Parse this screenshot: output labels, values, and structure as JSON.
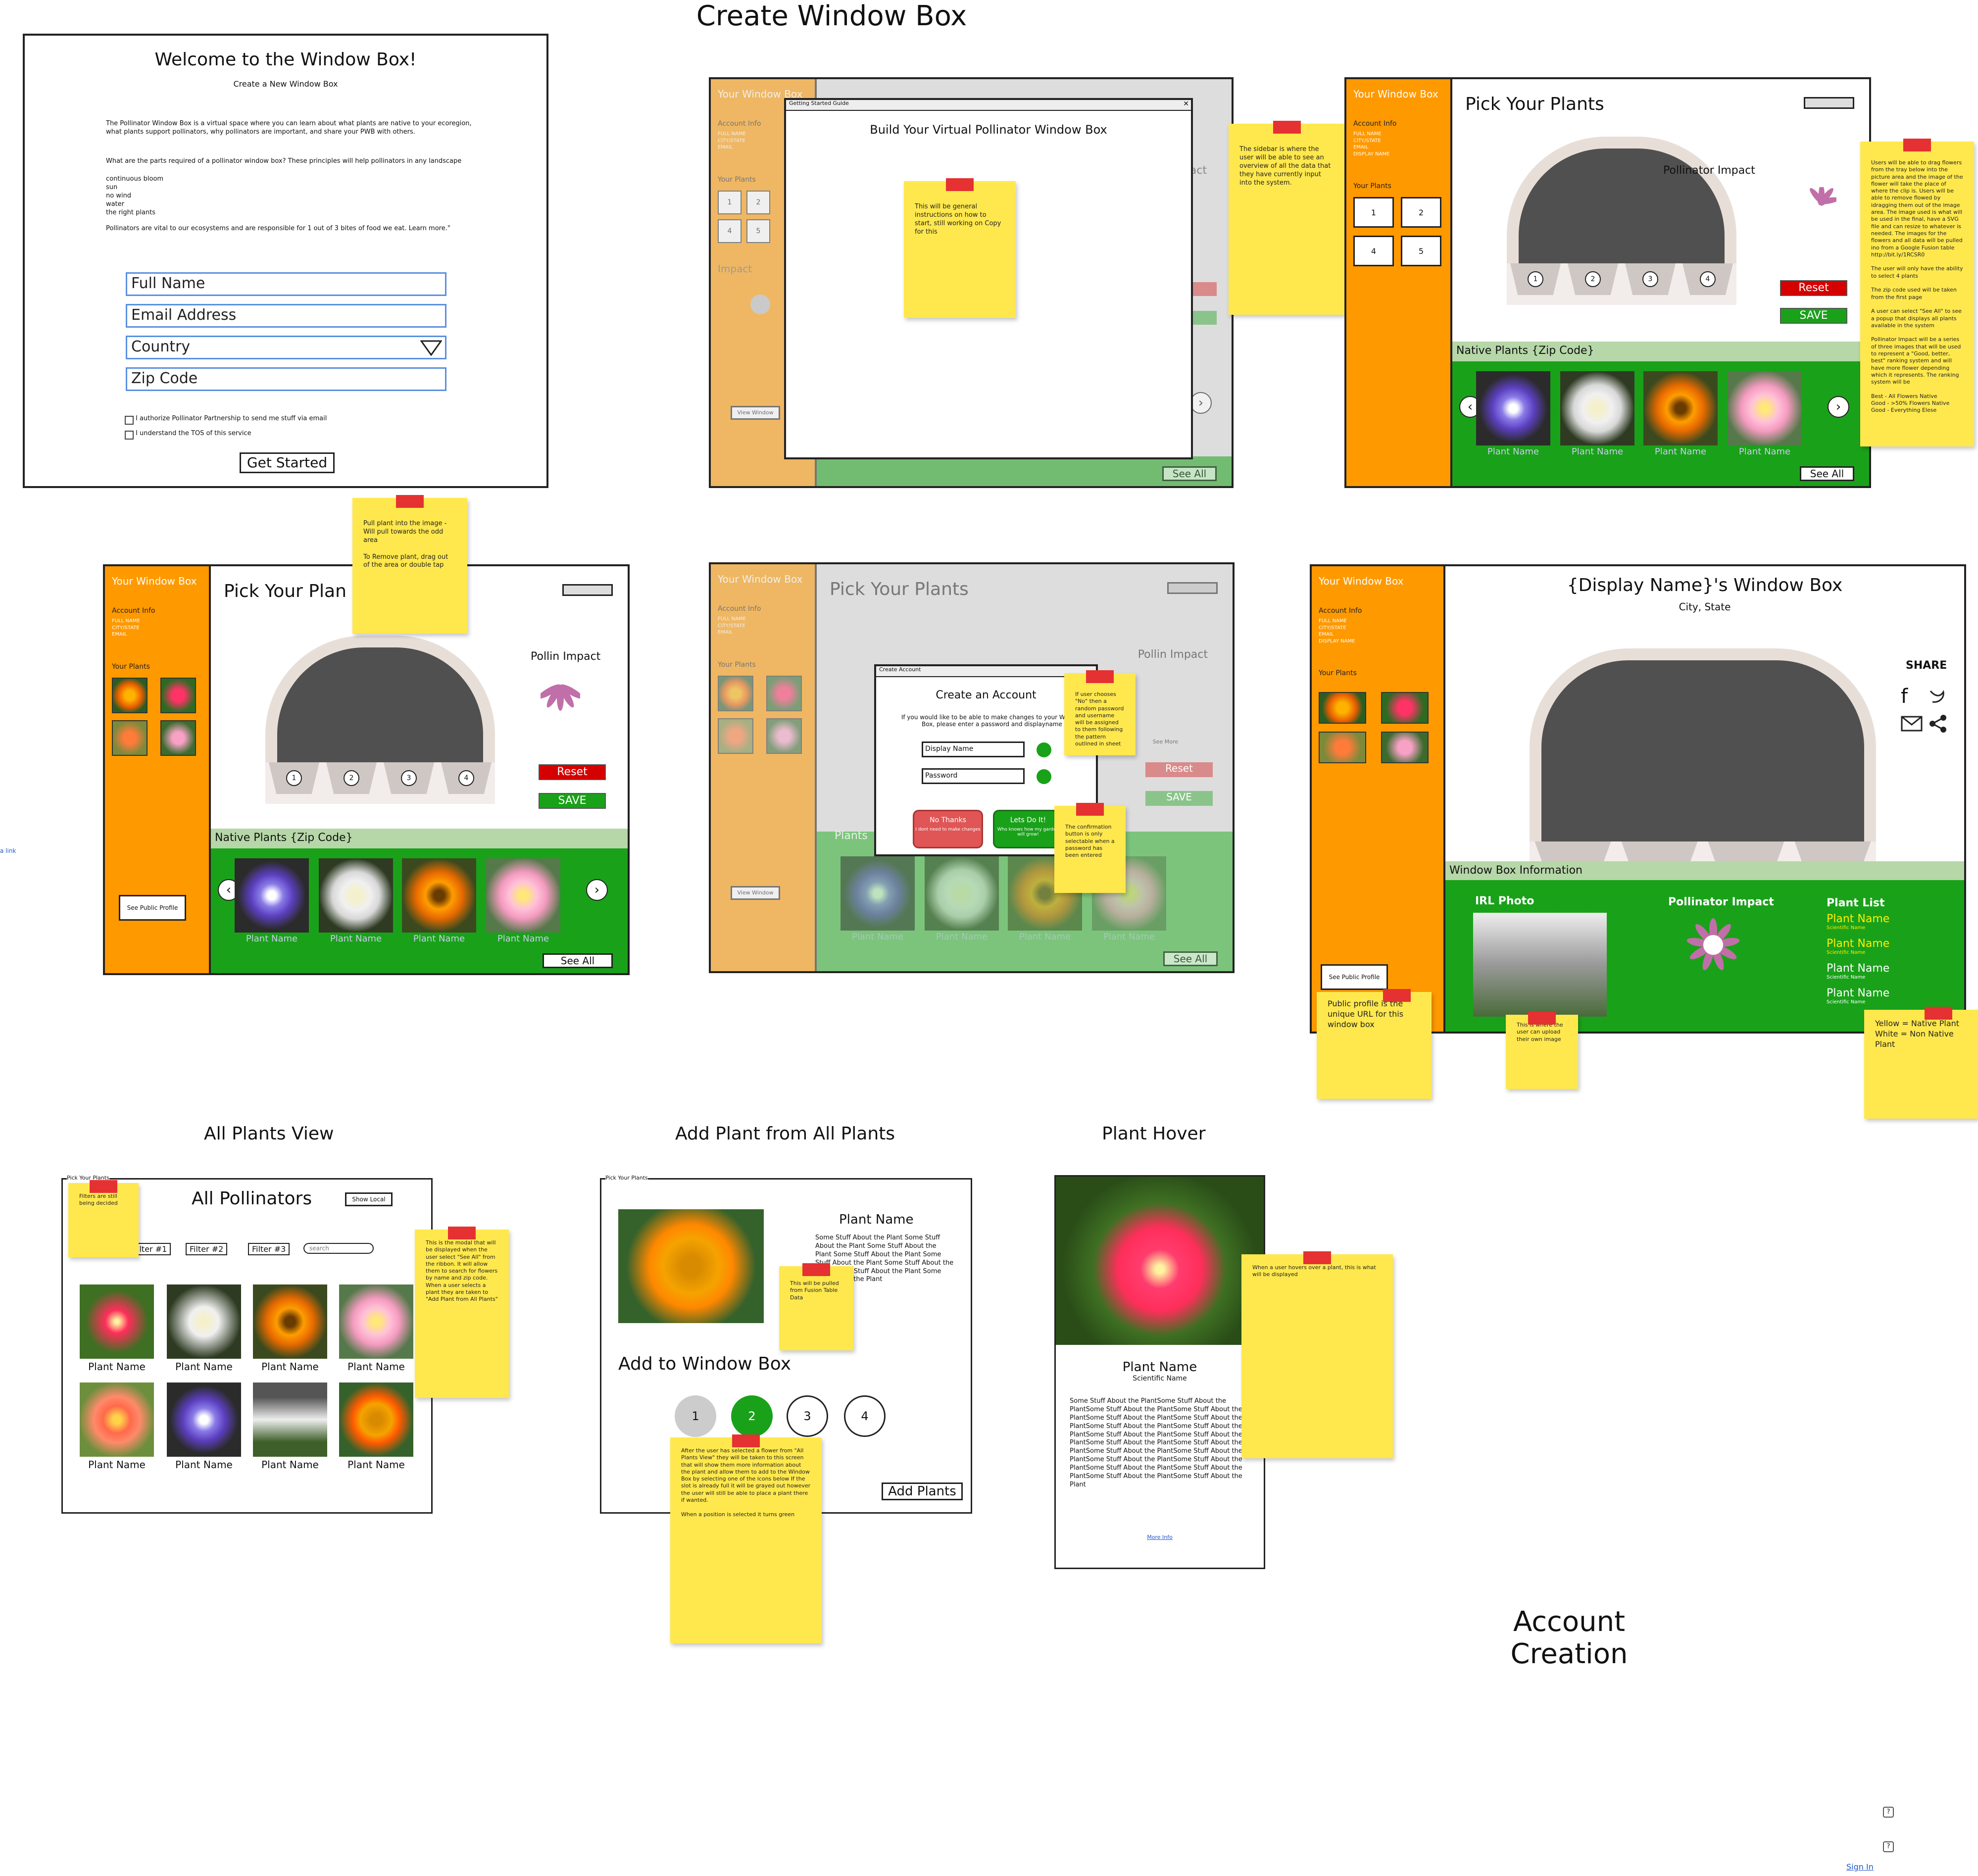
{
  "page": {
    "create_title": "Create Window Box",
    "account_title": "Account Creation",
    "all_plants_title": "All Plants View",
    "add_plant_title": "Add Plant from All Plants",
    "hover_title": "Plant Hover",
    "link_text": "a link",
    "sign_in": "Sign In",
    "help_icon_1": "?",
    "help_icon_2": "?"
  },
  "welcome": {
    "heading": "Welcome to the Window Box!",
    "subheading": "Create a New Window Box",
    "intro": "The Pollinator Window Box is a virtual space where you can learn about what plants are native to your ecoregion, what plants support pollinators, why pollinators are important, and share your PWB with others.",
    "parts_q": "What are the parts required of a pollinator window box? These principles will help pollinators in any landscape",
    "parts": [
      "continuous bloom",
      "sun",
      "no wind",
      "water",
      "the right plants"
    ],
    "fact": "Pollinators are vital to our ecosystems and are responsible for 1 out of 3 bites of food we eat. Learn more.\"",
    "full_name": "Full Name",
    "email": "Email Address",
    "country": "Country",
    "zip": "Zip Code",
    "check1": "I authorize Pollinator Partnership to send me stuff via email",
    "check2": "I understand the TOS of this service",
    "cta": "Get Started"
  },
  "sidebar": {
    "title": "Your Window Box",
    "account_info": "Account Info",
    "fields": [
      "FULL NAME",
      "CITY/STATE",
      "EMAIL",
      "DISPLAY NAME"
    ],
    "your_plants": "Your Plants",
    "impact": "Impact",
    "see_public": "See Public Profile",
    "view_window": "View Window"
  },
  "guide": {
    "title_bar": "Getting Started Guide",
    "close": "✕",
    "heading": "Build Your Virtual Pollinator Window Box",
    "note": "This will be general instructions on how to start, still working on Copy for this"
  },
  "pick": {
    "heading": "Pick Your Plants",
    "heading_short": "Pick Your Plan",
    "impact": "Pollinator Impact",
    "impact_short": "Pollin Impact",
    "reset": "Reset",
    "save": "SAVE",
    "native_head": "Native Plants {Zip Code}",
    "plants_label": "Plants",
    "plant_name": "Plant Name",
    "see_all": "See All",
    "see_more": "See More",
    "slots": [
      "1",
      "2",
      "3",
      "4"
    ],
    "left_arrow": "‹",
    "right_arrow": "›",
    "partial_act": "act"
  },
  "account_modal": {
    "title_bar": "Create Account",
    "heading": "Create an Account",
    "body": "If you would like to be able to make changes to your Window Box, please enter a password and displayname",
    "display_name": "Display Name",
    "password": "Password",
    "no_label": "No Thanks",
    "no_sub": "I dont need to make changes",
    "yes_label": "Lets Do It!",
    "yes_sub": "Who knows how my garden will grow!"
  },
  "profile": {
    "heading": "{Display Name}'s Window Box",
    "location": "City, State",
    "share": "SHARE",
    "info_head": "Window Box Information",
    "irl": "IRL Photo",
    "impact": "Pollinator Impact",
    "plant_list": "Plant List",
    "plants": [
      {
        "name": "Plant Name",
        "sci": "Scientific Name",
        "color": "#ffee00"
      },
      {
        "name": "Plant Name",
        "sci": "Scientific Name",
        "color": "#ffee00"
      },
      {
        "name": "Plant Name",
        "sci": "Scientific Name",
        "color": "#ffffff"
      },
      {
        "name": "Plant Name",
        "sci": "Scientific Name",
        "color": "#ffffff"
      }
    ]
  },
  "all_plants": {
    "corner": "Pick Your Plants",
    "heading": "All Pollinators",
    "show_local": "Show Local",
    "filters": [
      "Filter #1",
      "Filter #2",
      "Filter #3"
    ],
    "search": "search",
    "plant_name": "Plant Name"
  },
  "add_plant": {
    "corner": "Pick Your Plants",
    "plant_name": "Plant Name",
    "desc": "Some Stuff About the Plant Some Stuff About the Plant Some Stuff About the Plant Some Stuff About the Plant Some Stuff About the Plant Some Stuff About the Plant Some Stuff About the Plant Some Stuff About the Plant",
    "add_to": "Add to Window Box",
    "slots": [
      "1",
      "2",
      "3",
      "4"
    ],
    "add_btn": "Add Plants"
  },
  "hover": {
    "name": "Plant Name",
    "sci": "Scientific Name",
    "desc": "Some Stuff About the PlantSome Stuff About the PlantSome Stuff About the PlantSome Stuff About the PlantSome Stuff About the PlantSome Stuff About the PlantSome Stuff About the PlantSome Stuff About the PlantSome Stuff About the PlantSome Stuff About the PlantSome Stuff About the PlantSome Stuff About the PlantSome Stuff About the PlantSome Stuff About the PlantSome Stuff About the PlantSome Stuff About the PlantSome Stuff About the PlantSome Stuff About the PlantSome Stuff About the PlantSome Stuff About the Plant",
    "more": "More Info"
  },
  "notes": {
    "sidebar": "The sidebar is where the user will be able to see an overview of all the data that they have currently input into the system.",
    "drag": "Users will be able to drag flowers from the tray below into the picture area and the image of the flower will take the place of where the clip is. Users will be able to remove flowed by idragging them out of the image area. The image used is what will be used in the final, have a SVG file and can resize to whatever is needed. The images for the flowers and all data will be pulled ino from a Google Fusion table http://bit.ly/1RCSR0\n\nThe user will only have the ability to select 4 plants\n\nThe zip code used will be taken from the first page\n\nA user can select \"See All\" to see a popup that displays all plants available in the system\n\nPollinator Impact will be a series of three images that will be used to represent a \"Good, better, best\" ranking system and will have more flower depending which it represents. The ranking system will be\n\nBest - All Flowers Native\nGood - >50% Flowers Native\nGood - Everything Elese",
    "pull": "Pull plant into the image - Will pull towards the odd area\n\nTo Remove plant, drag out of the area or double tap",
    "random": "If user chooses \"No\" then a random password and username will be assigned to them following the pattern outlined in sheet",
    "confirm": "The confirmation button is only selectable when a password has been entered",
    "public": "Public profile is the unique URL for this window box",
    "upload": "This is where the user can upload their own image",
    "legend": "Yellow = Native Plant\nWhite = Non Native Plant",
    "filters": "Filters are still being decided",
    "modal": "This is the modal that will be displayed when the user select \"See All\" from the ribbon. It will allow them to search for flowers by name and zip code. When a user selects a plant they are taken to \"Add Plant from All Plants\"",
    "fusion": "This will be pulled from Fusion Table Data",
    "after": "After the user has selected a flower from \"All Plants View\" they will be taken to this screen that will show them more information about the plant and allow them to add to the Window Box by selecting one of the icons below If the slot is already full it will be grayed out however the user will still be able to place a plant there if wanted.\n\nWhen a position is selected it turns green",
    "hover": "When a user hovers over a plant, this is what will be displayed"
  },
  "colors": {
    "sidebar": "#ff9900",
    "strip": "#1aa11a",
    "strip_head": "#b6d7a8",
    "sticky": "#ffe84d",
    "tape": "#e53131",
    "input_border": "#5a8fe0"
  }
}
